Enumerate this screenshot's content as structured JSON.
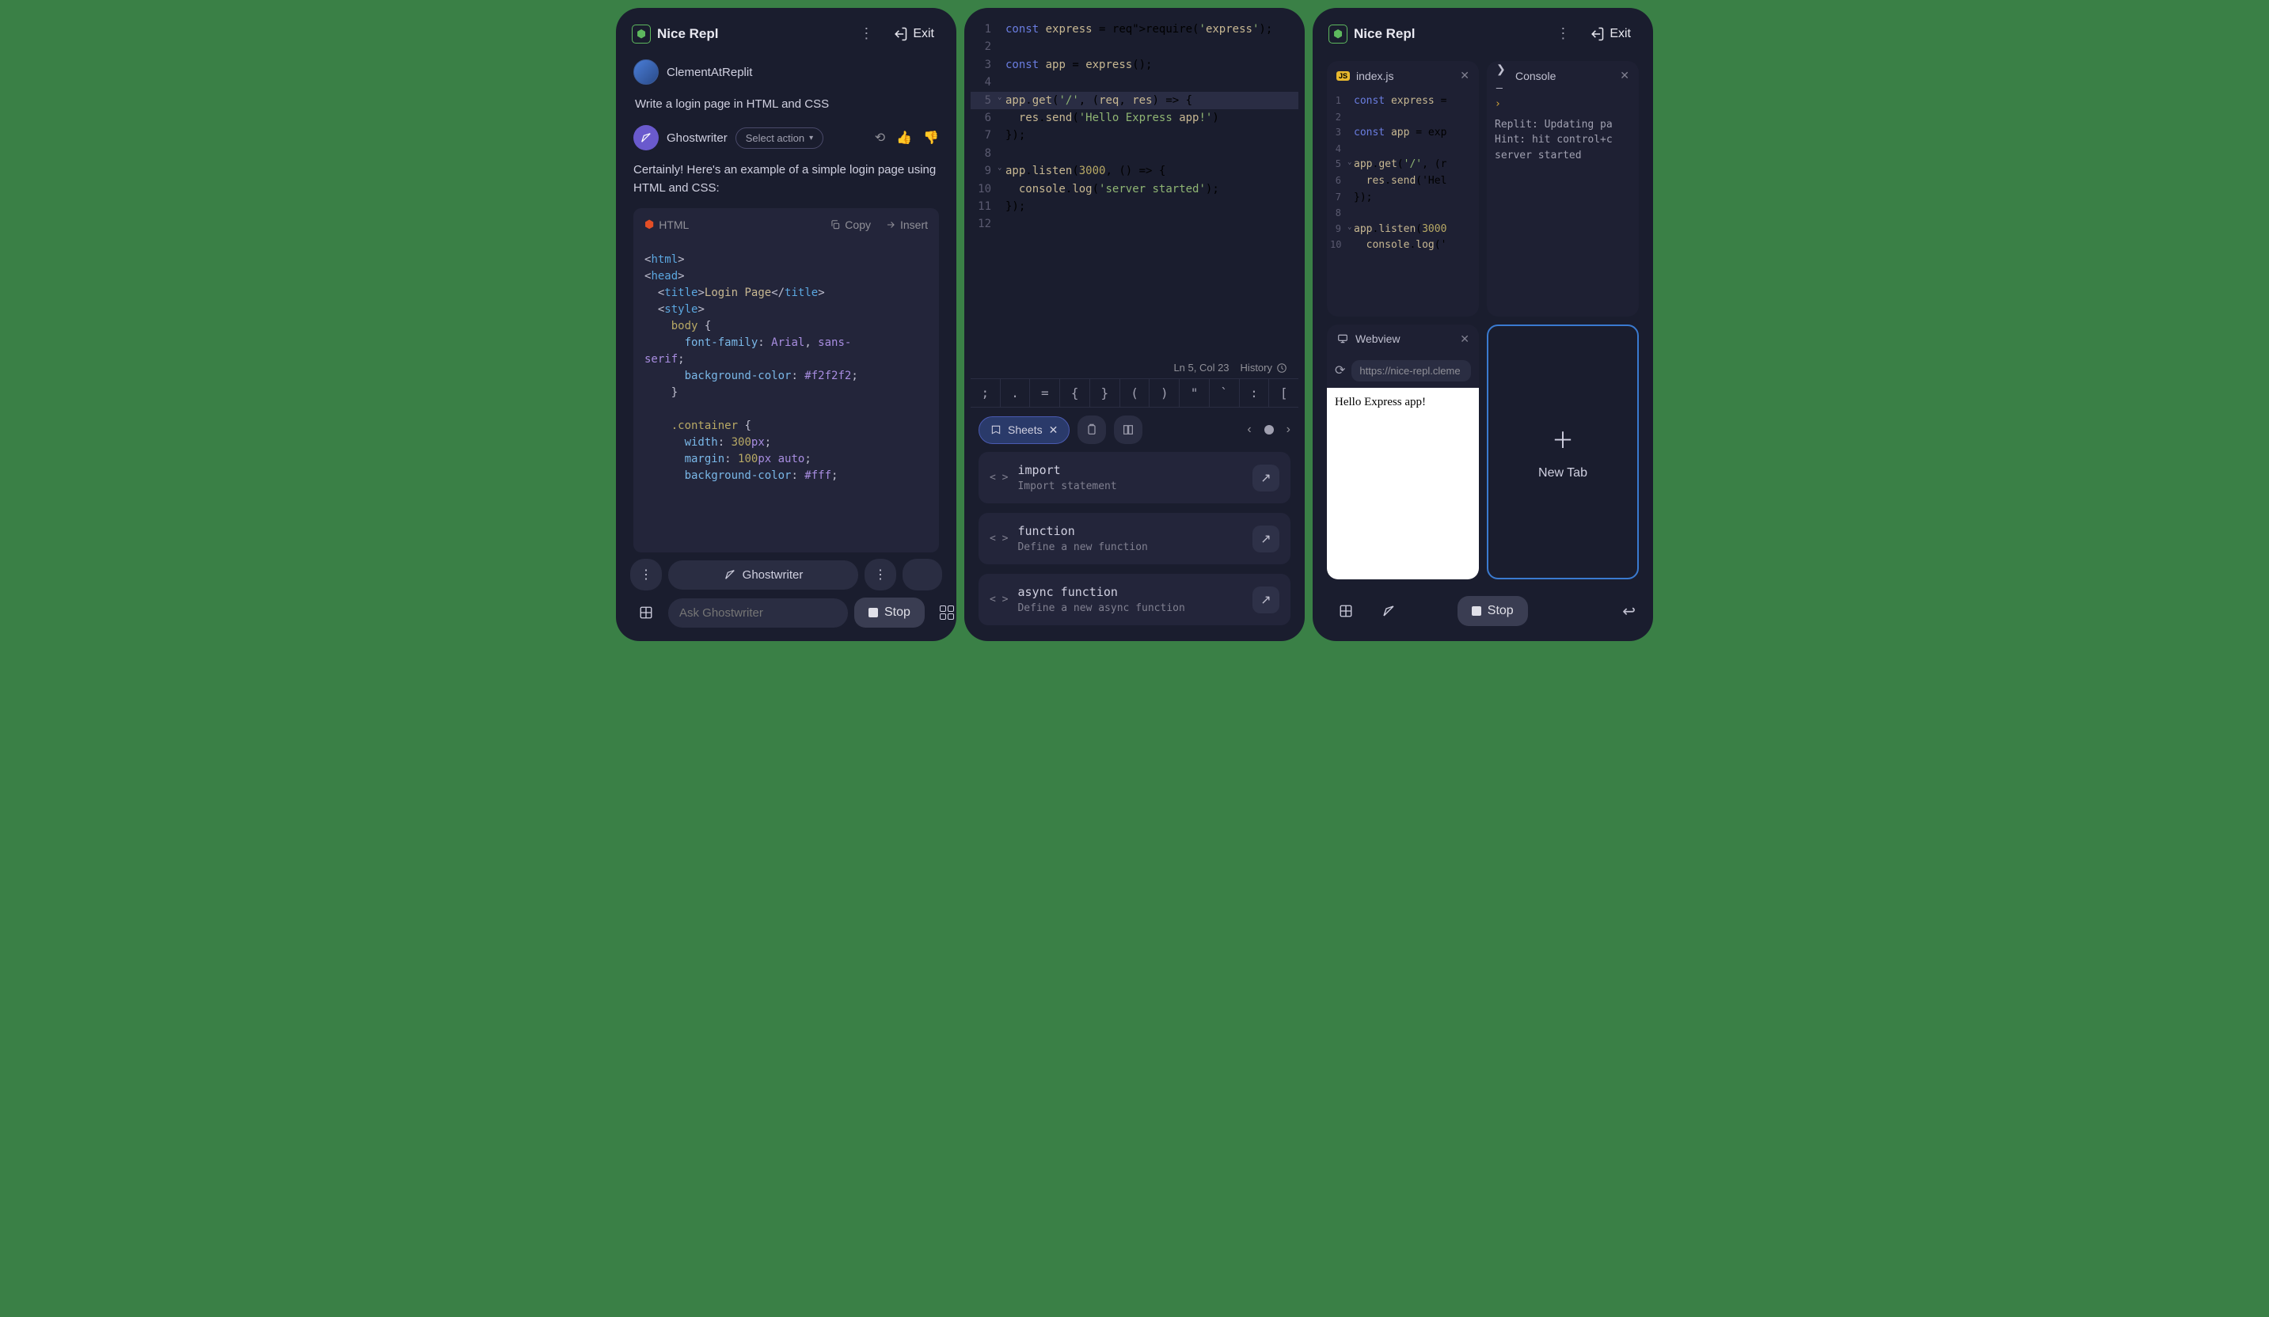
{
  "header": {
    "title": "Nice Repl",
    "exit": "Exit"
  },
  "chat": {
    "user": "ClementAtReplit",
    "user_msg": "Write a login page in HTML and CSS",
    "gw": "Ghostwriter",
    "select": "Select action",
    "gw_msg": "Certainly! Here's an example of a simple login page using HTML and CSS:",
    "code_lang": "HTML",
    "copy": "Copy",
    "insert": "Insert",
    "footer_gw": "Ghostwriter",
    "ask_ph": "Ask Ghostwriter",
    "stop": "Stop"
  },
  "editor": {
    "status": "Ln 5, Col 23",
    "history": "History",
    "symbols": [
      ";",
      ".",
      "=",
      "{",
      "}",
      "(",
      ")",
      "\"",
      "`",
      ":",
      "["
    ],
    "sheets": "Sheets",
    "snips": [
      {
        "t": "import",
        "s": "Import statement"
      },
      {
        "t": "function",
        "s": "Define a new function"
      },
      {
        "t": "async function",
        "s": "Define a new async function"
      }
    ],
    "code": [
      {
        "n": "1",
        "c": "const express = require('express');",
        "req": true
      },
      {
        "n": "2",
        "c": ""
      },
      {
        "n": "3",
        "c": "const app = express();"
      },
      {
        "n": "4",
        "c": ""
      },
      {
        "n": "5",
        "c": "app.get('/', (req, res) => {",
        "f": true,
        "a": true
      },
      {
        "n": "6",
        "c": "  res.send('Hello Express app!')"
      },
      {
        "n": "7",
        "c": "});"
      },
      {
        "n": "8",
        "c": ""
      },
      {
        "n": "9",
        "c": "app.listen(3000, () => {",
        "f": true
      },
      {
        "n": "10",
        "c": "  console.log('server started');"
      },
      {
        "n": "11",
        "c": "});"
      },
      {
        "n": "12",
        "c": ""
      }
    ]
  },
  "panes": {
    "file": "index.js",
    "console": "Console",
    "webview": "Webview",
    "url": "https://nice-repl.cleme",
    "hello": "Hello Express app!",
    "newtab": "New Tab",
    "stop": "Stop",
    "console_lines": [
      "Replit: Updating pa",
      "Hint: hit control+c",
      "server started"
    ],
    "code": [
      {
        "n": "1",
        "c": "const express ="
      },
      {
        "n": "2",
        "c": ""
      },
      {
        "n": "3",
        "c": "const app = exp"
      },
      {
        "n": "4",
        "c": ""
      },
      {
        "n": "5",
        "c": "app.get('/', (r",
        "f": true
      },
      {
        "n": "6",
        "c": "  res.send('Hel"
      },
      {
        "n": "7",
        "c": "});"
      },
      {
        "n": "8",
        "c": ""
      },
      {
        "n": "9",
        "c": "app.listen(3000",
        "f": true
      },
      {
        "n": "10",
        "c": "  console.log('"
      }
    ]
  }
}
